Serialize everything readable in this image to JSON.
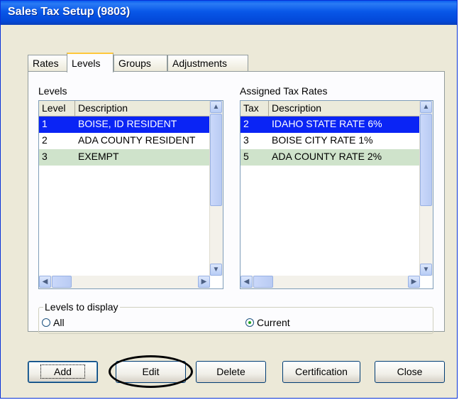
{
  "window": {
    "title": "Sales Tax Setup (9803)"
  },
  "tabs": [
    {
      "label": "Rates"
    },
    {
      "label": "Levels",
      "active": true
    },
    {
      "label": "Groups"
    },
    {
      "label": "Adjustments"
    }
  ],
  "levels": {
    "label": "Levels",
    "columns": [
      "Level",
      "Description"
    ],
    "rows": [
      {
        "level": "1",
        "description": "BOISE, ID RESIDENT",
        "state": "selected"
      },
      {
        "level": "2",
        "description": "ADA COUNTY RESIDENT",
        "state": "normal"
      },
      {
        "level": "3",
        "description": "EXEMPT",
        "state": "highlighted"
      }
    ]
  },
  "assigned": {
    "label": "Assigned Tax Rates",
    "columns": [
      "Tax",
      "Description"
    ],
    "rows": [
      {
        "tax": "2",
        "description": "IDAHO STATE RATE 6%",
        "state": "selected"
      },
      {
        "tax": "3",
        "description": "BOISE CITY RATE 1%",
        "state": "normal"
      },
      {
        "tax": "5",
        "description": "ADA COUNTY RATE 2%",
        "state": "highlighted"
      }
    ]
  },
  "display": {
    "legend": "Levels to display",
    "options": [
      {
        "label": "All",
        "checked": false
      },
      {
        "label": "Current",
        "checked": true
      }
    ]
  },
  "buttons": {
    "add": "Add",
    "edit": "Edit",
    "delete": "Delete",
    "certification": "Certification",
    "close": "Close"
  },
  "colors": {
    "selected_row": "#0a24f5",
    "highlighted_row": "#cfe3cb",
    "title_bar": "#0857e8"
  }
}
